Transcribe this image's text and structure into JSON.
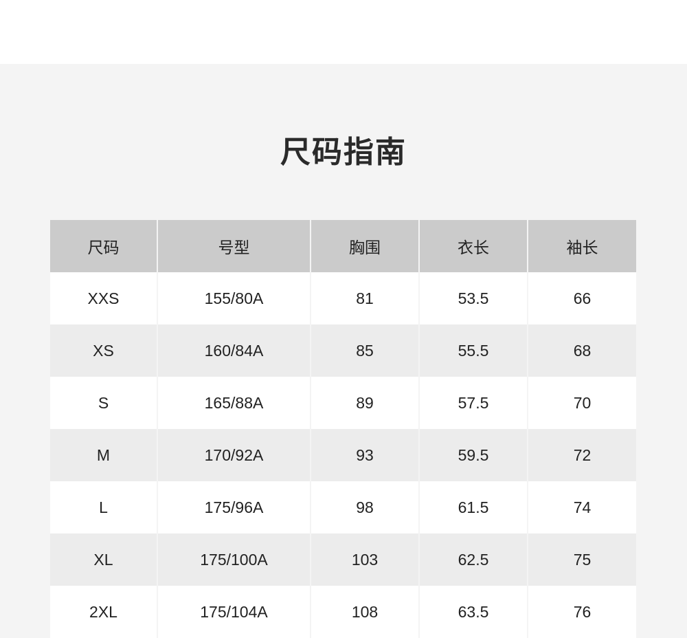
{
  "page": {
    "title": "尺码指南"
  },
  "table": {
    "headers": [
      "尺码",
      "号型",
      "胸围",
      "衣长",
      "袖长"
    ],
    "rows": [
      [
        "XXS",
        "155/80A",
        "81",
        "53.5",
        "66"
      ],
      [
        "XS",
        "160/84A",
        "85",
        "55.5",
        "68"
      ],
      [
        "S",
        "165/88A",
        "89",
        "57.5",
        "70"
      ],
      [
        "M",
        "170/92A",
        "93",
        "59.5",
        "72"
      ],
      [
        "L",
        "175/96A",
        "98",
        "61.5",
        "74"
      ],
      [
        "XL",
        "175/100A",
        "103",
        "62.5",
        "75"
      ],
      [
        "2XL",
        "175/104A",
        "108",
        "63.5",
        "76"
      ]
    ]
  },
  "colors": {
    "panel_background": "#f4f4f4",
    "header_background": "#cbcbcb",
    "row_alt_background": "#ececec",
    "row_background": "#ffffff",
    "text": "#222222"
  }
}
